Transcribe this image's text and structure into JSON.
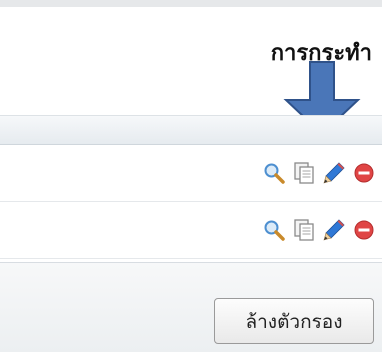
{
  "header": {
    "title": "การกระทำ"
  },
  "colors": {
    "arrow": "#4a76b8",
    "arrow_stroke": "#2f528a",
    "delete": "#e04545",
    "pencil": "#2f78d6"
  },
  "rows": [
    {
      "actions": [
        "magnifier-icon",
        "copy-icon",
        "pencil-icon",
        "delete-icon"
      ]
    },
    {
      "actions": [
        "magnifier-icon",
        "copy-icon",
        "pencil-icon",
        "delete-icon"
      ]
    }
  ],
  "footer": {
    "clear_filter_label": "ล้างตัวกรอง"
  }
}
